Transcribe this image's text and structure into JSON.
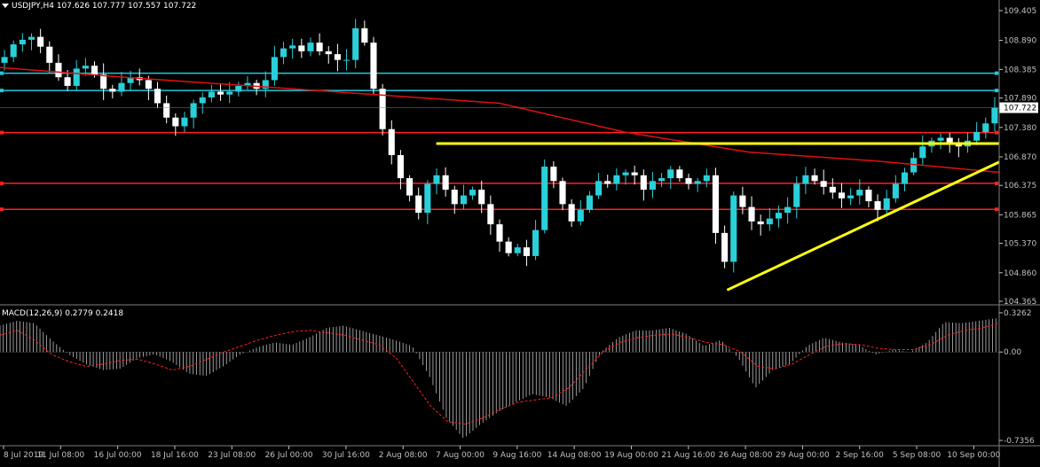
{
  "window": {
    "symbol_header": "USDJPY,H4  107.626 107.777 107.557 107.722",
    "indicator_header": "MACD(12,26,9) 0.2779 0.2418"
  },
  "colors": {
    "background": "#000000",
    "axis": "#c0c0c0",
    "bull_candle": "#2ad0d9",
    "bear_candle": "#ffffff",
    "moving_average": "#e01010",
    "resistance_line": "#ff2020",
    "cyan_line": "#20c8d8",
    "trendline": "#ffff10",
    "macd_histogram": "#c0c0c0",
    "macd_signal": "#ff2020",
    "price_tag_bg": "#ffffff",
    "price_tag_text": "#000000"
  },
  "chart_data": [
    {
      "type": "candlestick",
      "symbol": "USDJPY",
      "timeframe": "H4",
      "ohlc_current": {
        "open": 107.626,
        "high": 107.777,
        "low": 107.557,
        "close": 107.722
      },
      "current_price_label": "107.722",
      "ylim": [
        104.365,
        109.405
      ],
      "y_tick_labels": [
        "109.405",
        "108.890",
        "108.385",
        "107.890",
        "107.380",
        "106.870",
        "106.375",
        "105.865",
        "105.370",
        "104.860",
        "104.365"
      ],
      "x_tick_labels": [
        "8 Jul 2019",
        "11 Jul 08:00",
        "16 Jul 00:00",
        "18 Jul 16:00",
        "23 Jul 08:00",
        "26 Jul 00:00",
        "30 Jul 16:00",
        "2 Aug 08:00",
        "7 Aug 00:00",
        "9 Aug 16:00",
        "14 Aug 08:00",
        "19 Aug 00:00",
        "21 Aug 16:00",
        "26 Aug 08:00",
        "29 Aug 00:00",
        "2 Sep 16:00",
        "5 Sep 08:00",
        "10 Sep 00:00"
      ],
      "close_path": [
        108.6,
        108.82,
        108.9,
        108.95,
        108.78,
        108.5,
        108.25,
        108.1,
        108.4,
        108.45,
        108.3,
        108.05,
        108.0,
        108.15,
        108.25,
        108.2,
        108.05,
        107.8,
        107.55,
        107.4,
        107.55,
        107.8,
        107.9,
        108.0,
        107.95,
        108.0,
        108.1,
        108.15,
        108.05,
        108.2,
        108.6,
        108.75,
        108.8,
        108.7,
        108.85,
        108.7,
        108.65,
        108.55,
        108.55,
        109.1,
        108.85,
        108.05,
        107.35,
        106.9,
        106.5,
        106.2,
        105.9,
        106.4,
        106.55,
        106.3,
        106.05,
        106.2,
        106.3,
        106.05,
        105.7,
        105.4,
        105.2,
        105.3,
        105.15,
        105.6,
        106.7,
        106.45,
        106.05,
        105.75,
        105.95,
        106.2,
        106.45,
        106.4,
        106.55,
        106.6,
        106.55,
        106.3,
        106.45,
        106.5,
        106.65,
        106.5,
        106.4,
        106.45,
        106.55,
        105.55,
        105.05,
        106.2,
        106.0,
        105.75,
        105.7,
        105.8,
        105.9,
        106.0,
        106.4,
        106.55,
        106.45,
        106.35,
        106.25,
        106.15,
        106.2,
        106.3,
        106.1,
        105.95,
        106.15,
        106.4,
        106.6,
        106.85,
        107.05,
        107.15,
        107.2,
        107.1,
        107.05,
        107.15,
        107.3,
        107.45,
        107.722
      ],
      "moving_average": [
        108.42,
        108.25,
        108.1,
        107.95,
        107.8,
        107.3,
        106.95,
        106.8,
        106.6
      ],
      "horizontal_levels": [
        {
          "name": "cyan-level-upper",
          "price": 108.32,
          "color": "cyan"
        },
        {
          "name": "cyan-level-lower",
          "price": 108.02,
          "color": "cyan"
        },
        {
          "name": "red-level-1",
          "price": 107.29,
          "color": "red"
        },
        {
          "name": "red-level-2",
          "price": 106.41,
          "color": "red"
        },
        {
          "name": "red-level-3",
          "price": 105.96,
          "color": "red"
        }
      ],
      "trendlines": [
        {
          "name": "yellow-resistance",
          "x_start_frac": 0.4366,
          "x_end_frac": 1.0,
          "price_start": 107.1,
          "price_end": 107.1
        },
        {
          "name": "yellow-support",
          "x_start_frac": 0.7277,
          "x_end_frac": 1.0,
          "price_start": 104.56,
          "price_end": 106.78
        }
      ]
    },
    {
      "type": "macd",
      "params": "12,26,9",
      "macd_value": 0.2779,
      "signal_value": 0.2418,
      "ylim": [
        -0.7356,
        0.3262
      ],
      "y_tick_labels": [
        "0.3262",
        "0.00",
        "-0.7356"
      ],
      "histogram_path": [
        0.22,
        0.26,
        0.24,
        0.1,
        -0.02,
        -0.1,
        -0.15,
        -0.14,
        -0.05,
        -0.02,
        -0.08,
        -0.18,
        -0.2,
        -0.12,
        -0.02,
        0.04,
        0.08,
        0.06,
        0.12,
        0.2,
        0.22,
        0.18,
        0.14,
        0.1,
        0.05,
        -0.2,
        -0.55,
        -0.72,
        -0.6,
        -0.5,
        -0.42,
        -0.35,
        -0.38,
        -0.45,
        -0.3,
        0.0,
        0.12,
        0.18,
        0.18,
        0.2,
        0.15,
        0.05,
        0.1,
        -0.05,
        -0.3,
        -0.15,
        -0.1,
        0.05,
        0.12,
        0.08,
        0.06,
        -0.02,
        0.02,
        0.0,
        0.08,
        0.25,
        0.24,
        0.26,
        0.28
      ],
      "signal_path": [
        0.14,
        0.18,
        0.1,
        -0.02,
        -0.08,
        -0.12,
        -0.1,
        -0.07,
        -0.06,
        -0.1,
        -0.15,
        -0.12,
        -0.06,
        0.0,
        0.05,
        0.1,
        0.14,
        0.17,
        0.18,
        0.16,
        0.14,
        0.1,
        0.06,
        -0.05,
        -0.25,
        -0.45,
        -0.58,
        -0.6,
        -0.55,
        -0.48,
        -0.42,
        -0.4,
        -0.38,
        -0.3,
        -0.15,
        0.0,
        0.08,
        0.12,
        0.14,
        0.15,
        0.12,
        0.08,
        0.06,
        0.0,
        -0.12,
        -0.14,
        -0.1,
        -0.02,
        0.05,
        0.07,
        0.06,
        0.03,
        0.02,
        0.02,
        0.06,
        0.14,
        0.18,
        0.2,
        0.24
      ]
    }
  ]
}
